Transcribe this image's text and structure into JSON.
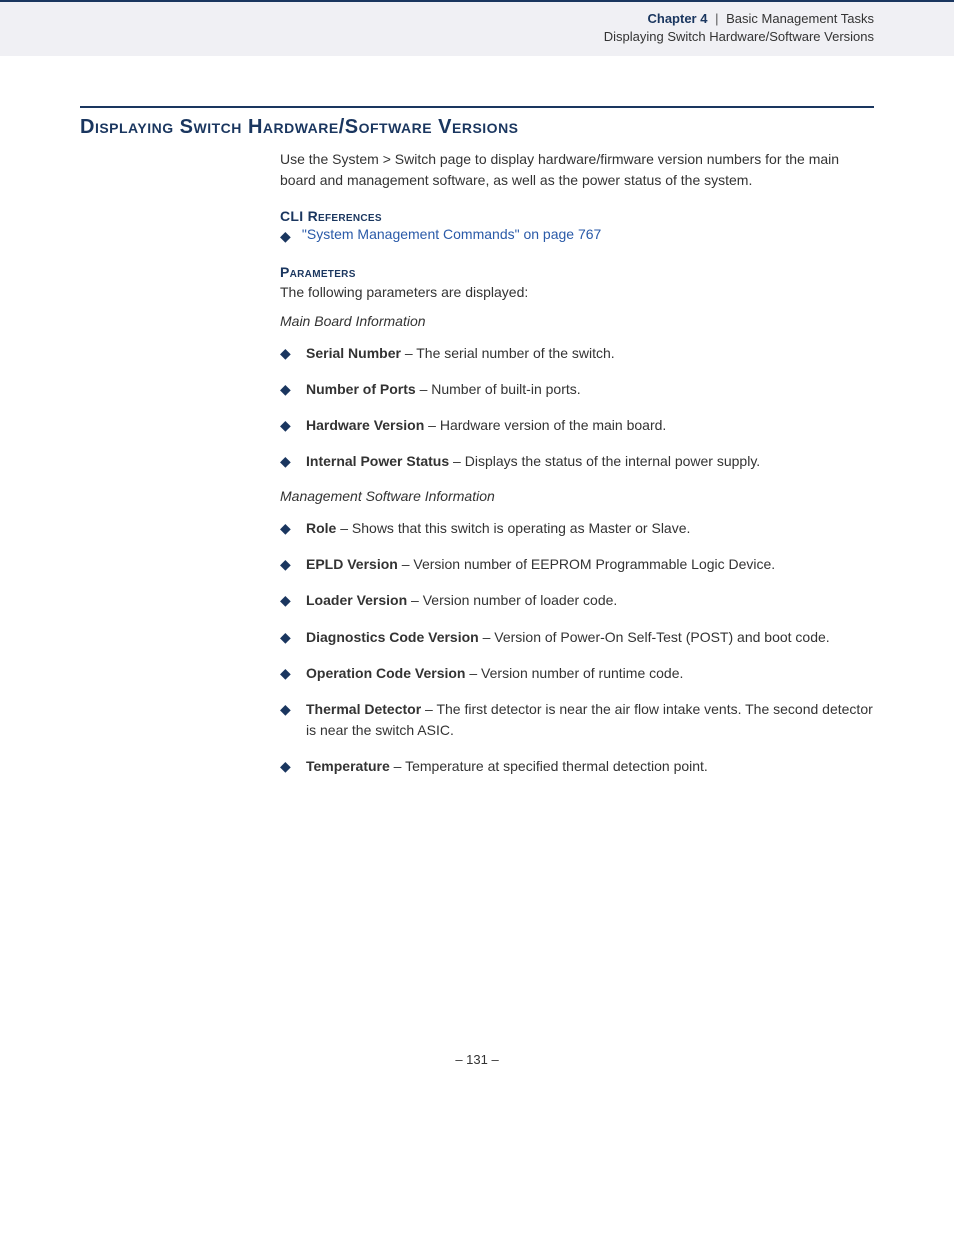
{
  "header": {
    "chapter_label": "Chapter 4",
    "separator": "|",
    "chapter_title": "Basic Management Tasks",
    "subtitle": "Displaying Switch Hardware/Software Versions"
  },
  "section": {
    "title": "Displaying Switch Hardware/Software Versions",
    "intro": "Use the System > Switch page to display hardware/firmware version numbers for the main board and management software, as well as the power status of the system."
  },
  "cli": {
    "heading": "CLI References",
    "link_text": "\"System Management Commands\" on page 767"
  },
  "params": {
    "heading": "Parameters",
    "intro": "The following parameters are displayed:",
    "group1_title": "Main Board Information",
    "group1": [
      {
        "term": "Serial Number",
        "desc": " – The serial number of the switch."
      },
      {
        "term": "Number of Ports",
        "desc": " – Number of built-in ports."
      },
      {
        "term": "Hardware Version",
        "desc": " – Hardware version of the main board."
      },
      {
        "term": "Internal Power Status",
        "desc": " – Displays the status of the internal power supply."
      }
    ],
    "group2_title": "Management Software Information",
    "group2": [
      {
        "term": "Role",
        "desc": " – Shows that this switch is operating as Master or Slave."
      },
      {
        "term": "EPLD Version",
        "desc": " – Version number of EEPROM Programmable Logic Device."
      },
      {
        "term": "Loader Version",
        "desc": " – Version number of loader code."
      },
      {
        "term": "Diagnostics Code Version",
        "desc": " – Version of Power-On Self-Test (POST) and boot code."
      },
      {
        "term": "Operation Code Version",
        "desc": " – Version number of runtime code."
      },
      {
        "term": "Thermal Detector",
        "desc": " – The first detector is near the air flow intake vents. The second detector is near the switch ASIC."
      },
      {
        "term": "Temperature",
        "desc": " – Temperature at specified thermal detection point."
      }
    ]
  },
  "footer": {
    "page": "–  131  –"
  }
}
